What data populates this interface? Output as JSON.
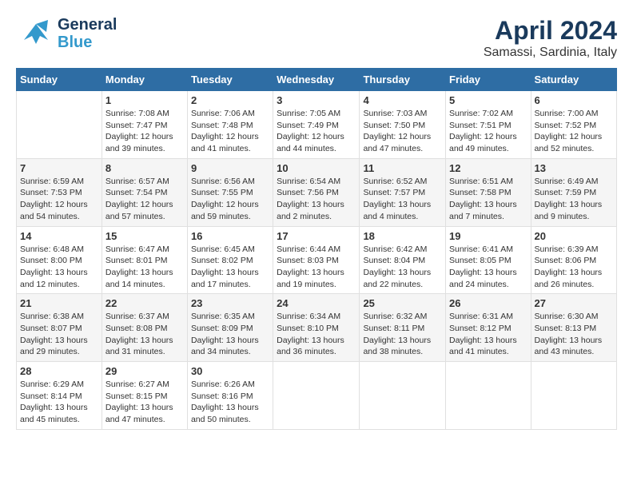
{
  "header": {
    "logo_line1": "General",
    "logo_line2": "Blue",
    "title": "April 2024",
    "subtitle": "Samassi, Sardinia, Italy"
  },
  "calendar": {
    "days_of_week": [
      "Sunday",
      "Monday",
      "Tuesday",
      "Wednesday",
      "Thursday",
      "Friday",
      "Saturday"
    ],
    "weeks": [
      [
        {
          "day": "",
          "info": ""
        },
        {
          "day": "1",
          "info": "Sunrise: 7:08 AM\nSunset: 7:47 PM\nDaylight: 12 hours\nand 39 minutes."
        },
        {
          "day": "2",
          "info": "Sunrise: 7:06 AM\nSunset: 7:48 PM\nDaylight: 12 hours\nand 41 minutes."
        },
        {
          "day": "3",
          "info": "Sunrise: 7:05 AM\nSunset: 7:49 PM\nDaylight: 12 hours\nand 44 minutes."
        },
        {
          "day": "4",
          "info": "Sunrise: 7:03 AM\nSunset: 7:50 PM\nDaylight: 12 hours\nand 47 minutes."
        },
        {
          "day": "5",
          "info": "Sunrise: 7:02 AM\nSunset: 7:51 PM\nDaylight: 12 hours\nand 49 minutes."
        },
        {
          "day": "6",
          "info": "Sunrise: 7:00 AM\nSunset: 7:52 PM\nDaylight: 12 hours\nand 52 minutes."
        }
      ],
      [
        {
          "day": "7",
          "info": "Sunrise: 6:59 AM\nSunset: 7:53 PM\nDaylight: 12 hours\nand 54 minutes."
        },
        {
          "day": "8",
          "info": "Sunrise: 6:57 AM\nSunset: 7:54 PM\nDaylight: 12 hours\nand 57 minutes."
        },
        {
          "day": "9",
          "info": "Sunrise: 6:56 AM\nSunset: 7:55 PM\nDaylight: 12 hours\nand 59 minutes."
        },
        {
          "day": "10",
          "info": "Sunrise: 6:54 AM\nSunset: 7:56 PM\nDaylight: 13 hours\nand 2 minutes."
        },
        {
          "day": "11",
          "info": "Sunrise: 6:52 AM\nSunset: 7:57 PM\nDaylight: 13 hours\nand 4 minutes."
        },
        {
          "day": "12",
          "info": "Sunrise: 6:51 AM\nSunset: 7:58 PM\nDaylight: 13 hours\nand 7 minutes."
        },
        {
          "day": "13",
          "info": "Sunrise: 6:49 AM\nSunset: 7:59 PM\nDaylight: 13 hours\nand 9 minutes."
        }
      ],
      [
        {
          "day": "14",
          "info": "Sunrise: 6:48 AM\nSunset: 8:00 PM\nDaylight: 13 hours\nand 12 minutes."
        },
        {
          "day": "15",
          "info": "Sunrise: 6:47 AM\nSunset: 8:01 PM\nDaylight: 13 hours\nand 14 minutes."
        },
        {
          "day": "16",
          "info": "Sunrise: 6:45 AM\nSunset: 8:02 PM\nDaylight: 13 hours\nand 17 minutes."
        },
        {
          "day": "17",
          "info": "Sunrise: 6:44 AM\nSunset: 8:03 PM\nDaylight: 13 hours\nand 19 minutes."
        },
        {
          "day": "18",
          "info": "Sunrise: 6:42 AM\nSunset: 8:04 PM\nDaylight: 13 hours\nand 22 minutes."
        },
        {
          "day": "19",
          "info": "Sunrise: 6:41 AM\nSunset: 8:05 PM\nDaylight: 13 hours\nand 24 minutes."
        },
        {
          "day": "20",
          "info": "Sunrise: 6:39 AM\nSunset: 8:06 PM\nDaylight: 13 hours\nand 26 minutes."
        }
      ],
      [
        {
          "day": "21",
          "info": "Sunrise: 6:38 AM\nSunset: 8:07 PM\nDaylight: 13 hours\nand 29 minutes."
        },
        {
          "day": "22",
          "info": "Sunrise: 6:37 AM\nSunset: 8:08 PM\nDaylight: 13 hours\nand 31 minutes."
        },
        {
          "day": "23",
          "info": "Sunrise: 6:35 AM\nSunset: 8:09 PM\nDaylight: 13 hours\nand 34 minutes."
        },
        {
          "day": "24",
          "info": "Sunrise: 6:34 AM\nSunset: 8:10 PM\nDaylight: 13 hours\nand 36 minutes."
        },
        {
          "day": "25",
          "info": "Sunrise: 6:32 AM\nSunset: 8:11 PM\nDaylight: 13 hours\nand 38 minutes."
        },
        {
          "day": "26",
          "info": "Sunrise: 6:31 AM\nSunset: 8:12 PM\nDaylight: 13 hours\nand 41 minutes."
        },
        {
          "day": "27",
          "info": "Sunrise: 6:30 AM\nSunset: 8:13 PM\nDaylight: 13 hours\nand 43 minutes."
        }
      ],
      [
        {
          "day": "28",
          "info": "Sunrise: 6:29 AM\nSunset: 8:14 PM\nDaylight: 13 hours\nand 45 minutes."
        },
        {
          "day": "29",
          "info": "Sunrise: 6:27 AM\nSunset: 8:15 PM\nDaylight: 13 hours\nand 47 minutes."
        },
        {
          "day": "30",
          "info": "Sunrise: 6:26 AM\nSunset: 8:16 PM\nDaylight: 13 hours\nand 50 minutes."
        },
        {
          "day": "",
          "info": ""
        },
        {
          "day": "",
          "info": ""
        },
        {
          "day": "",
          "info": ""
        },
        {
          "day": "",
          "info": ""
        }
      ]
    ]
  }
}
